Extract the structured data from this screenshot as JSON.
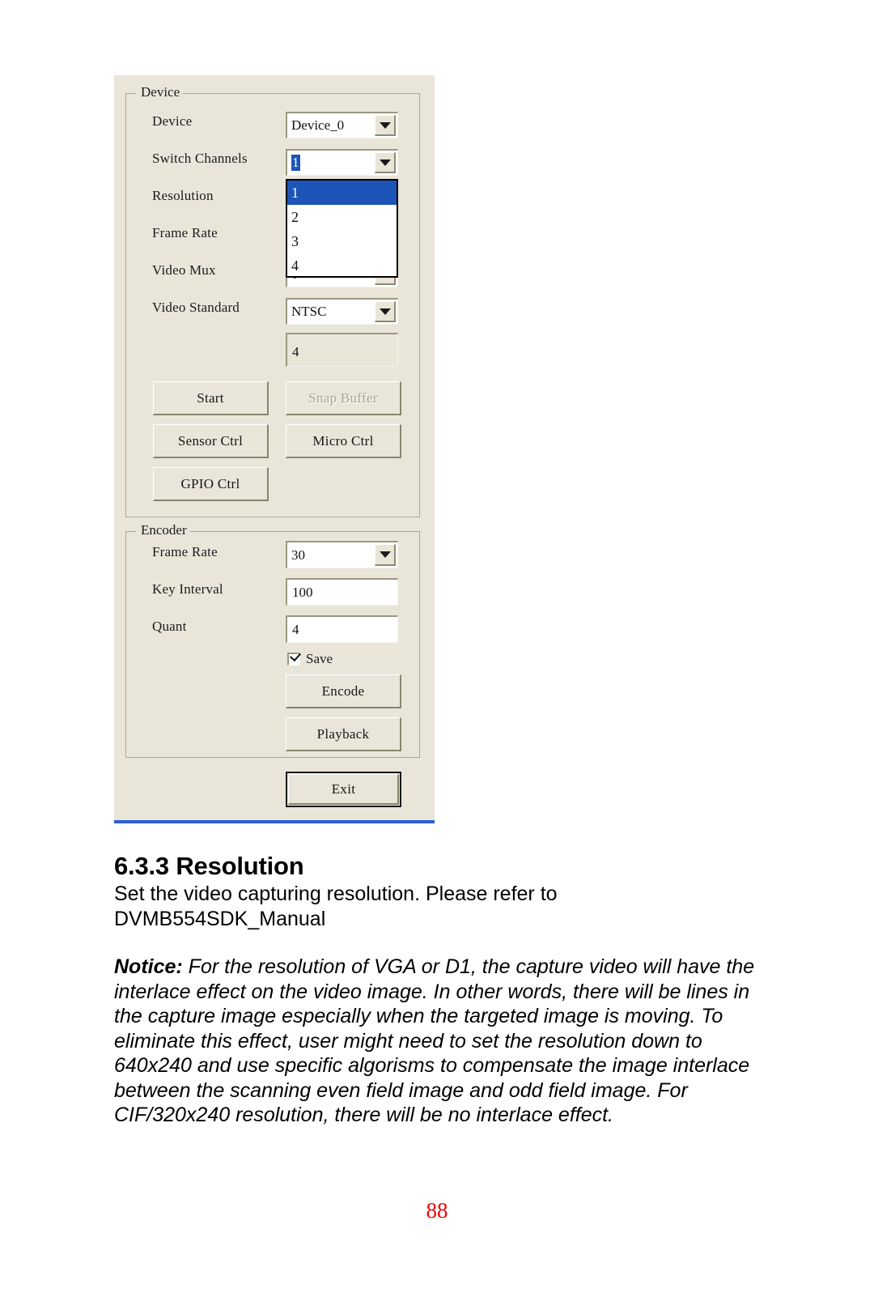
{
  "document": {
    "heading": "6.3.3 Resolution",
    "intro_paragraph": "Set the video capturing resolution. Please refer to DVMB554SDK_Manual",
    "notice_label": "Notice:",
    "notice_body": " For the resolution of VGA or D1, the capture video will have the interlace effect on the video image. In other words, there will be lines in the capture image especially when the targeted image is moving. To eliminate this effect, user might need to set the resolution down to 640x240 and use specific algorisms to compensate the image interlace between the scanning even field image and odd field image. For CIF/320x240 resolution, there will be no interlace effect.",
    "page_number": "88",
    "page_number_color": "#ee0000",
    "rule_color": "#2a5fd6"
  },
  "dialog": {
    "background_color": "#e9e6d9",
    "device_group": {
      "legend": "Device",
      "fields": {
        "device": {
          "label": "Device",
          "value": "Device_0",
          "control": "combobox"
        },
        "switch_channels": {
          "label": "Switch Channels",
          "value": "1",
          "control": "combobox",
          "state": "open",
          "options": [
            "1",
            "2",
            "3",
            "4"
          ],
          "selected_option": "1",
          "highlight_color": "#1c54b8"
        },
        "resolution": {
          "label": "Resolution",
          "control": "combobox"
        },
        "frame_rate": {
          "label": "Frame Rate",
          "control": "combobox"
        },
        "video_mux": {
          "label": "Video Mux",
          "value": "0",
          "control": "combobox"
        },
        "video_standard": {
          "label": "Video Standard",
          "value": "NTSC",
          "control": "combobox"
        },
        "extra_value": {
          "value": "4",
          "control": "textbox"
        }
      },
      "buttons": {
        "start": "Start",
        "snap_buffer": "Snap Buffer",
        "snap_buffer_state": "disabled",
        "sensor_ctrl": "Sensor Ctrl",
        "micro_ctrl": "Micro Ctrl",
        "gpio_ctrl": "GPIO Ctrl"
      }
    },
    "encoder_group": {
      "legend": "Encoder",
      "fields": {
        "frame_rate": {
          "label": "Frame Rate",
          "value": "30",
          "control": "combobox"
        },
        "key_interval": {
          "label": "Key Interval",
          "value": "100",
          "control": "textbox"
        },
        "quant": {
          "label": "Quant",
          "value": "4",
          "control": "textbox"
        }
      },
      "save_checkbox": {
        "label": "Save",
        "checked": true
      },
      "buttons": {
        "encode": "Encode",
        "playback": "Playback"
      }
    },
    "exit_button": "Exit"
  }
}
